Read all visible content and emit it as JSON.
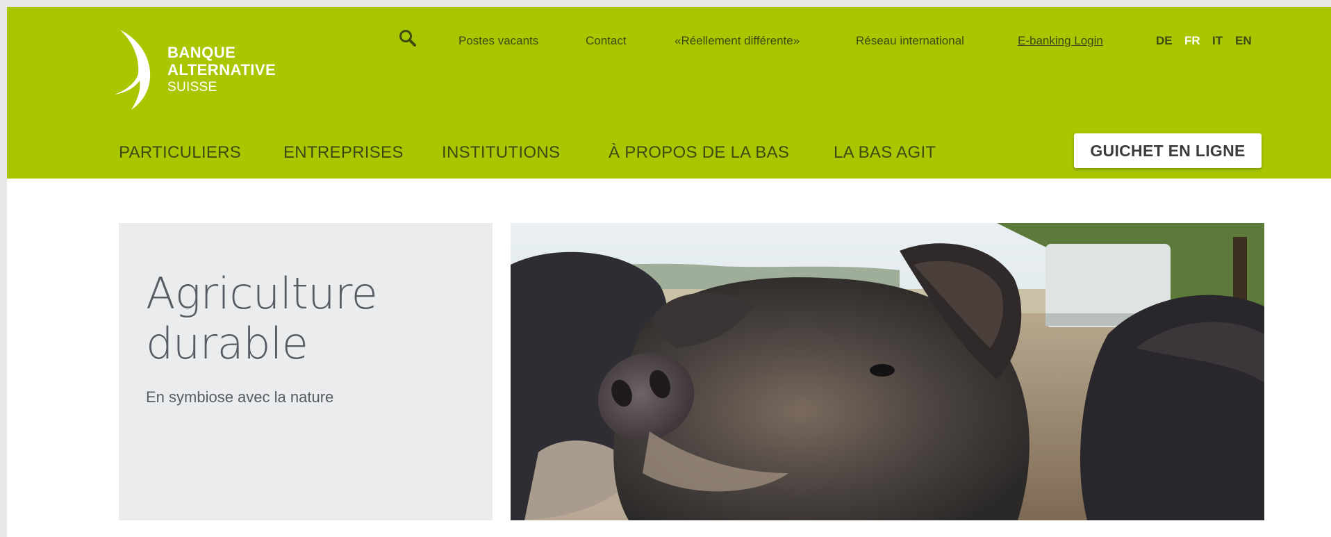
{
  "brand": {
    "name_line1": "BANQUE",
    "name_line2": "ALTERNATIVE",
    "name_line3": "SUISSE",
    "header_color": "#a9c600"
  },
  "utility_nav": {
    "search_icon": "search-icon",
    "links": [
      "Postes vacants",
      "Contact",
      "«Réellement différente»",
      "Réseau international",
      "E-banking Login"
    ],
    "languages": [
      "DE",
      "FR",
      "IT",
      "EN"
    ],
    "active_language": "FR"
  },
  "main_nav": {
    "items": [
      "PARTICULIERS",
      "ENTREPRISES",
      "INSTITUTIONS",
      "À PROPOS DE LA BAS",
      "LA BAS AGIT"
    ],
    "cta_label": "GUICHET EN LIGNE"
  },
  "hero": {
    "title_line1": "Agriculture",
    "title_line2": "durable",
    "subtitle": "En symbiose avec la nature"
  }
}
